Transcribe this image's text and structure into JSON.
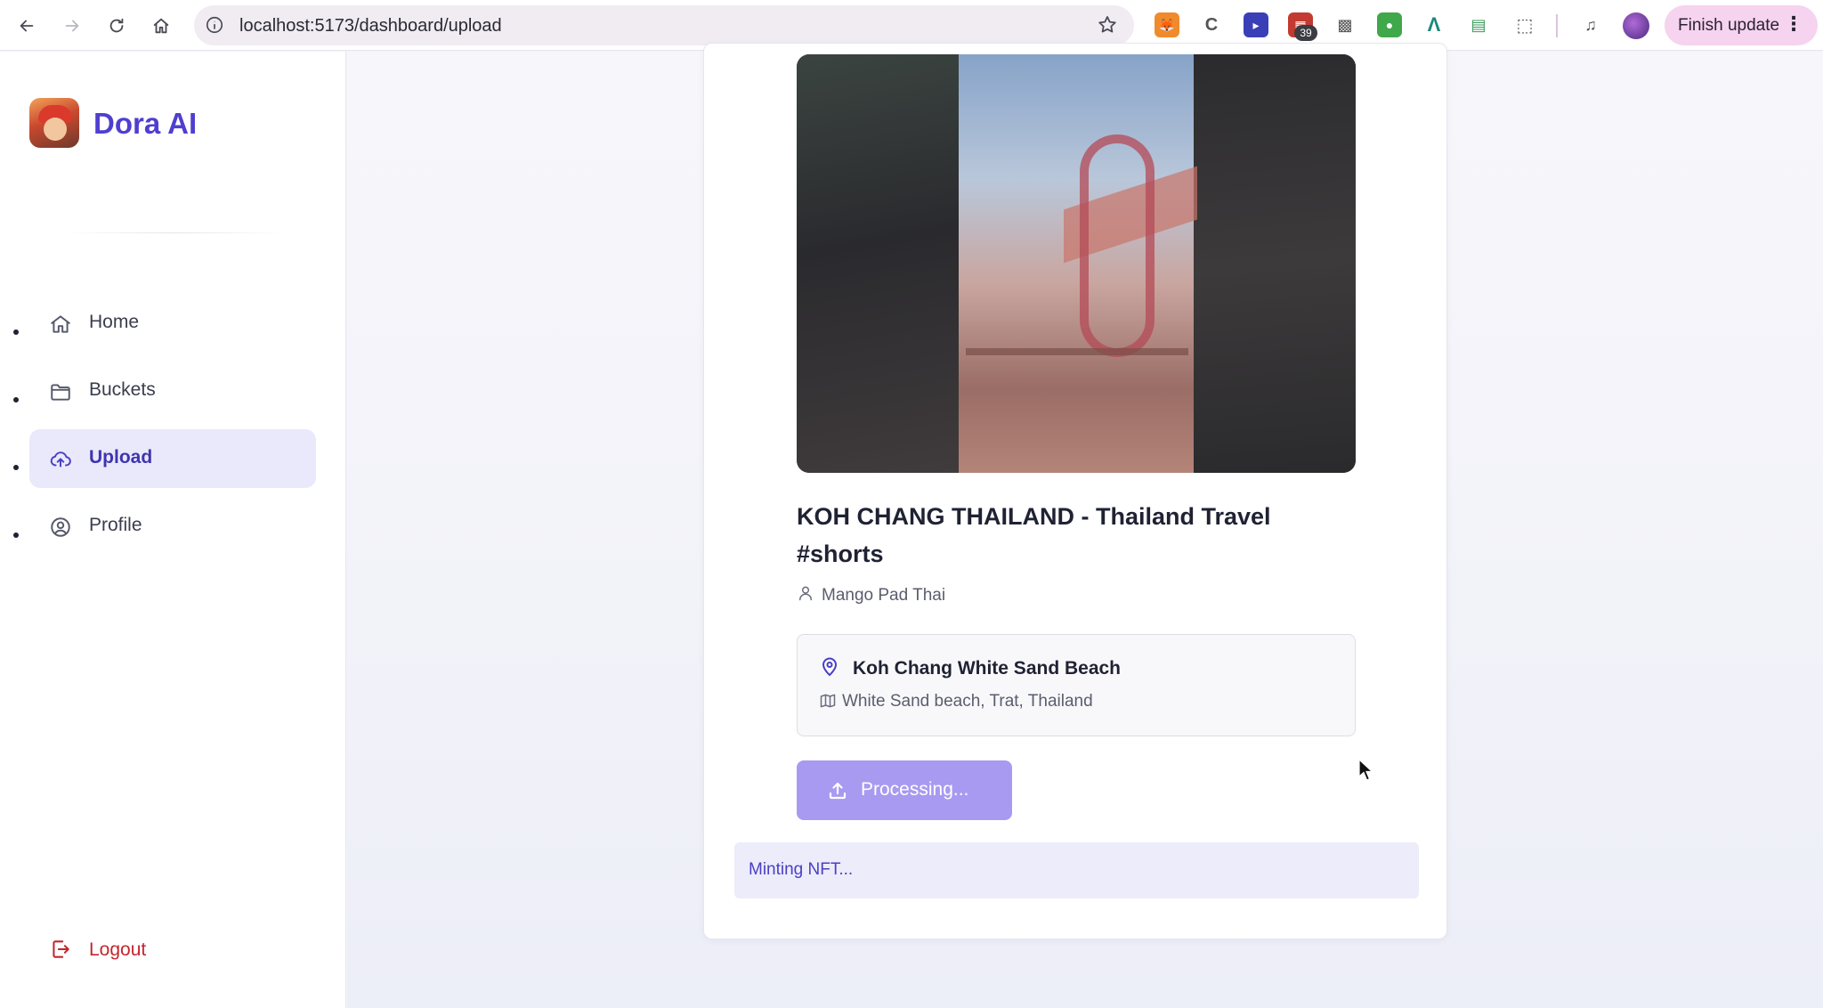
{
  "browser": {
    "url": "localhost:5173/dashboard/upload",
    "extension_badge": "39",
    "finish_update_label": "Finish update",
    "menu_glyph": "⋮"
  },
  "sidebar": {
    "brand": "Dora AI",
    "items": [
      {
        "label": "Home",
        "icon": "home-icon",
        "active": false
      },
      {
        "label": "Buckets",
        "icon": "folder-icon",
        "active": false
      },
      {
        "label": "Upload",
        "icon": "cloud-upload-icon",
        "active": true
      },
      {
        "label": "Profile",
        "icon": "user-circle-icon",
        "active": false
      }
    ],
    "logout_label": "Logout"
  },
  "video": {
    "title": "KOH CHANG THAILAND - Thailand Travel #shorts",
    "author": "Mango Pad Thai"
  },
  "location": {
    "name": "Koh Chang White Sand Beach",
    "address": "White Sand beach, Trat, Thailand"
  },
  "actions": {
    "process_label": "Processing..."
  },
  "status": {
    "message": "Minting NFT..."
  },
  "colors": {
    "accent": "#4f3fd0",
    "active_nav_bg": "#e9e9fb",
    "button_disabled": "#a89af0",
    "logout": "#c4262e"
  }
}
